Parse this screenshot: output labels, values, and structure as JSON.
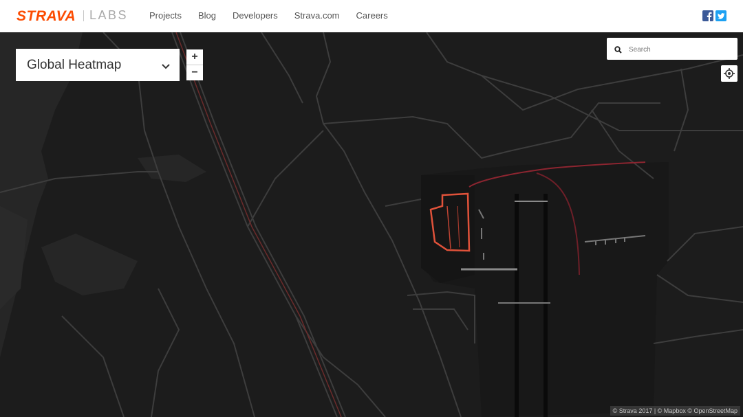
{
  "header": {
    "logo": "STRAVA",
    "logo_sub": "LABS",
    "nav": [
      "Projects",
      "Blog",
      "Developers",
      "Strava.com",
      "Careers"
    ]
  },
  "map_controls": {
    "selector_label": "Global Heatmap",
    "zoom_in": "+",
    "zoom_out": "−",
    "search_placeholder": "Search"
  },
  "attribution": "© Strava 2017 | © Mapbox © OpenStreetMap",
  "icons": {
    "facebook": "facebook-icon",
    "twitter": "twitter-icon",
    "search": "search-icon",
    "locate": "locate-icon",
    "caret": "chevron-down-icon"
  },
  "colors": {
    "brand": "#fc4c02",
    "map_bg": "#1c1c1c",
    "heat": "#e0523a"
  }
}
